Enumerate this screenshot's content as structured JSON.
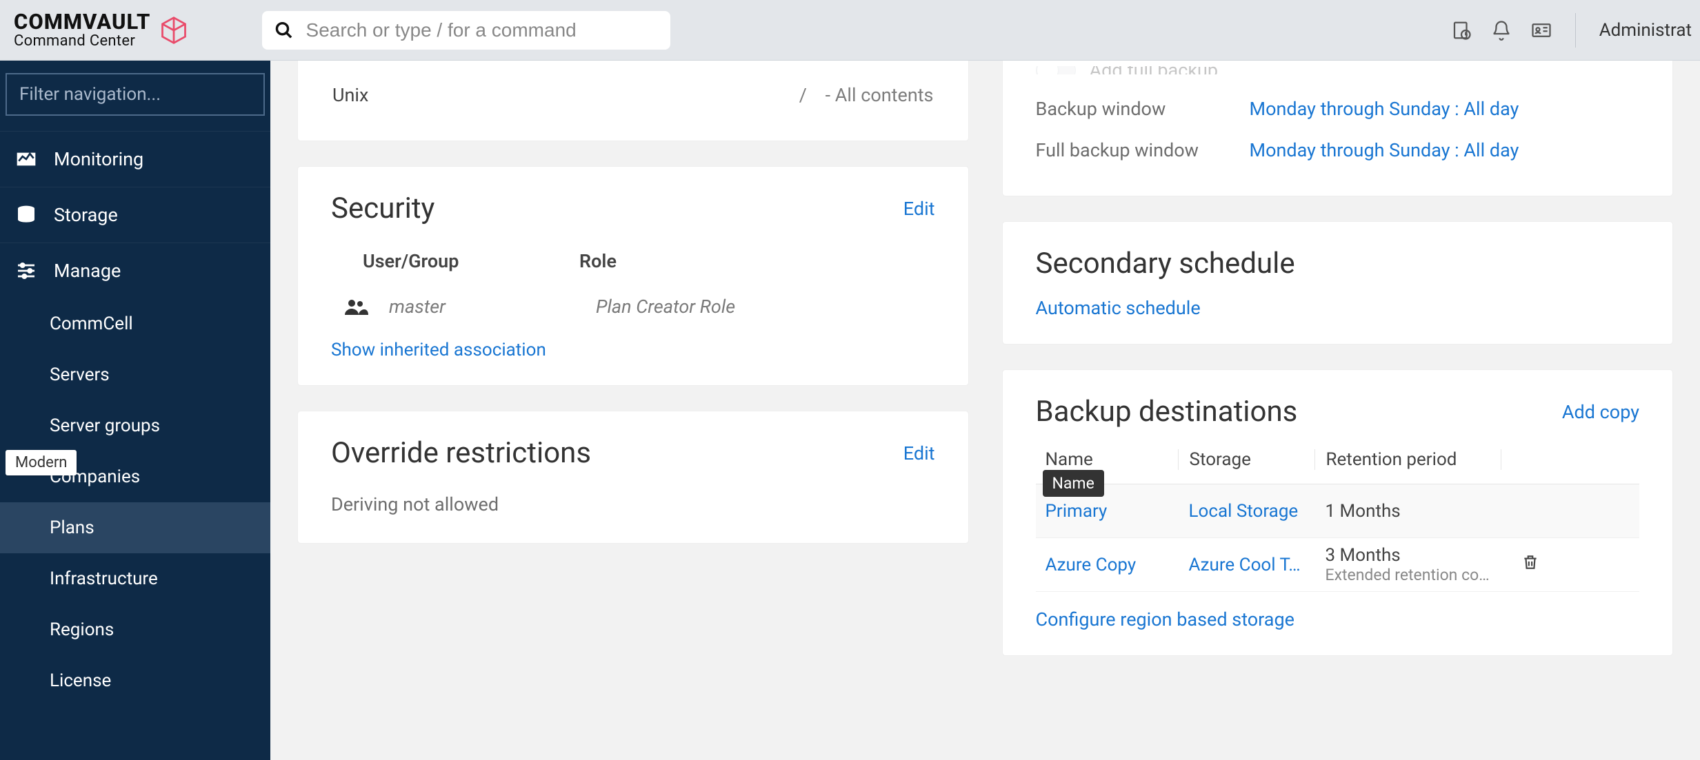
{
  "header": {
    "logo_top": "COMMVAULT",
    "logo_sub": "Command Center",
    "search_placeholder": "Search or type / for a command",
    "user": "Administrat"
  },
  "sidebar": {
    "filter_placeholder": "Filter navigation...",
    "items": [
      {
        "label": "Monitoring"
      },
      {
        "label": "Storage"
      },
      {
        "label": "Manage"
      }
    ],
    "manage_sub": [
      {
        "label": "CommCell"
      },
      {
        "label": "Servers"
      },
      {
        "label": "Server groups"
      },
      {
        "label": "Companies"
      },
      {
        "label": "Plans"
      },
      {
        "label": "Infrastructure"
      },
      {
        "label": "Regions"
      },
      {
        "label": "License"
      }
    ],
    "modern_tag": "Modern"
  },
  "left_col": {
    "unix_label": "Unix",
    "unix_sep": "/",
    "unix_value": "-  All contents",
    "security": {
      "title": "Security",
      "edit": "Edit",
      "header_user": "User/Group",
      "header_role": "Role",
      "user": "master",
      "role": "Plan Creator Role",
      "show_link": "Show inherited association"
    },
    "override": {
      "title": "Override restrictions",
      "edit": "Edit",
      "text": "Deriving not allowed"
    }
  },
  "right_col": {
    "rpo": {
      "add_full": "Add full backup",
      "window_label": "Backup window",
      "window_value": "Monday through Sunday : All day",
      "full_window_label": "Full backup window",
      "full_window_value": "Monday through Sunday : All day"
    },
    "secondary": {
      "title": "Secondary schedule",
      "link": "Automatic schedule"
    },
    "dest": {
      "title": "Backup destinations",
      "add": "Add copy",
      "col_name": "Name",
      "col_storage": "Storage",
      "col_retention": "Retention period",
      "tooltip": "Name",
      "rows": [
        {
          "name": "Primary",
          "storage": "Local Storage",
          "retention": "1 Months",
          "sub": ""
        },
        {
          "name": "Azure Copy",
          "storage": "Azure Cool T…",
          "retention": "3 Months",
          "sub": "Extended retention co…"
        }
      ],
      "region_link": "Configure region based storage"
    }
  }
}
